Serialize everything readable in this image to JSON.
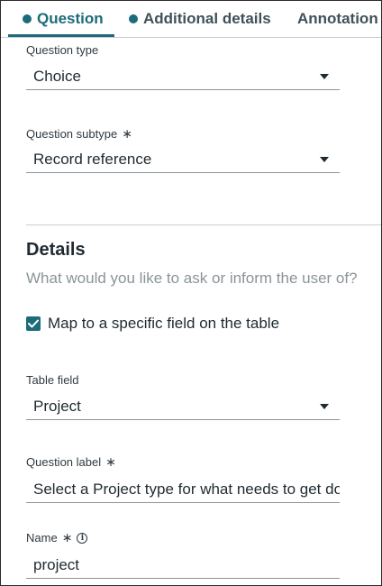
{
  "tabs": [
    {
      "label": "Question",
      "active": true
    },
    {
      "label": "Additional details",
      "active": false
    },
    {
      "label": "Annotation",
      "active": false
    }
  ],
  "question_type": {
    "label": "Question type",
    "value": "Choice"
  },
  "question_subtype": {
    "label": "Question subtype",
    "required_mark": "∗",
    "value": "Record reference"
  },
  "details": {
    "title": "Details",
    "subtitle": "What would you like to ask or inform the user of?",
    "map_checkbox": {
      "label": "Map to a specific field on the table",
      "checked": true
    }
  },
  "table_field": {
    "label": "Table field",
    "value": "Project"
  },
  "question_label": {
    "label": "Question label",
    "required_mark": "∗",
    "value": "Select a Project type for what needs to get do"
  },
  "name": {
    "label": "Name",
    "required_mark": "∗",
    "info_glyph": "i",
    "value": "project"
  },
  "colors": {
    "accent": "#1d6b7a",
    "text": "#1f2a30",
    "muted": "#8a9499",
    "border": "#c9cdd0"
  }
}
